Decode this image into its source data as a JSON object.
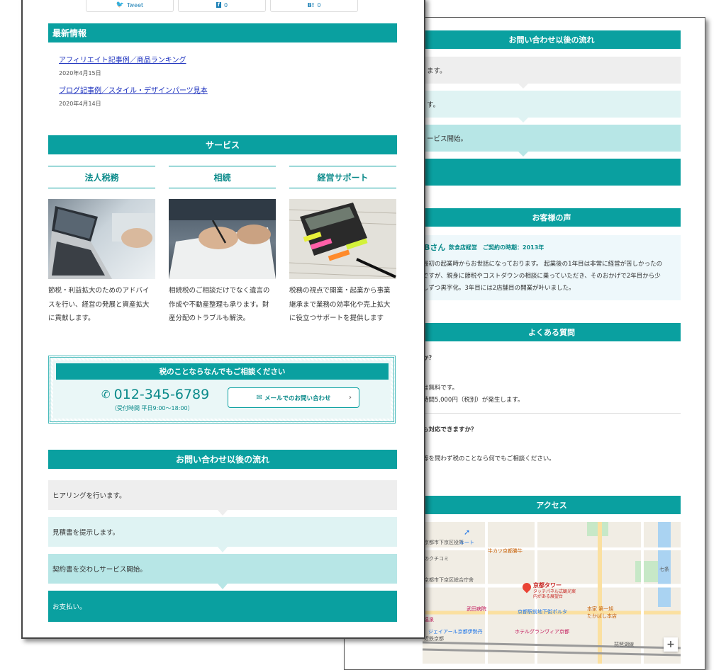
{
  "share": {
    "tweet": "Tweet",
    "facebook": "0",
    "hatena_label": "B!",
    "hatena_count": "0"
  },
  "news": {
    "heading": "最新情報",
    "items": [
      {
        "title": "アフィリエイト記事例／商品ランキング",
        "date": "2020年4月15日"
      },
      {
        "title": "ブログ記事例／スタイル・デザインパーツ見本",
        "date": "2020年4月14日"
      }
    ]
  },
  "services": {
    "heading": "サービス",
    "items": [
      {
        "title": "法人税務",
        "lines": [
          "節税・利益拡大のためのアドバイ",
          "スを行い、経営の発展と資産拡大",
          "に貢献します。"
        ]
      },
      {
        "title": "相続",
        "lines": [
          "相続税のご相談だけでなく遺言の",
          "作成や不動産整理も承ります。財",
          "産分配のトラブルも解決。"
        ]
      },
      {
        "title": "経営サポート",
        "lines": [
          "税務の視点で開業・起業から事業",
          "継承まで業務の効率化や売上拡大",
          "に役立つサポートを提供します"
        ]
      }
    ]
  },
  "contact": {
    "heading": "税のことならなんでもご相談ください",
    "phone": "012-345-6789",
    "hours": "（受付時間 平日9:00〜18:00）",
    "mail_button": "メールでのお問い合わせ"
  },
  "flow": {
    "heading": "お問い合わせ以後の流れ",
    "steps": [
      "ヒアリングを行います。",
      "見積書を提示します。",
      "契約書を交わしサービス開始。",
      "お支払い。"
    ]
  },
  "back": {
    "flow_heading": "お問い合わせ以後の流れ",
    "flow_partials": [
      "ます。",
      "す。",
      "ービス開始。"
    ],
    "voice_heading": "お客様の声",
    "voice_name": "Bさん",
    "voice_meta": "飲食店経営　ご契約の時期：2013年",
    "voice_lines": [
      "最初の起業時からお世話になっております。 起業後の1年目は非常に経営が苦しかったの",
      "ですが、親身に節税やコストダウンの相談に乗っていただき、そのおかげで2年目から少",
      "しずつ黒字化。3年目には2店舗目の開業が叶いました。"
    ],
    "faq_heading": "よくある質問",
    "faq_q1": "か？",
    "faq_a1a": "は無料です。",
    "faq_a1b": "時間5,000円（税別）が発生します。",
    "faq_q2": "も対応できますか？",
    "faq_a2": "等を問わず税のことなら何でもご相談ください。",
    "access_heading": "アクセス",
    "map_labels": {
      "ward": "京都市下京区役所",
      "route": "ルート",
      "tower": "京都タワー",
      "tower_sub": "タッチパネル式観光案内がある展望台",
      "station": "京都駅前地下街ポルタ",
      "hotel": "ホテルグランヴィア京都",
      "isetan": "ジェイアール京都伊勢丹",
      "hospital": "武田病院",
      "onsen": "温泉",
      "gyukatsu": "牛カツ京都勝牛",
      "honke": "本家 第一旭",
      "takabashi": "たかばし本店",
      "kuchikomi": "のクチコミ",
      "ward_office": "京都市下京区総合庁舎",
      "shichijo": "七条",
      "kinki": "近鉄京都",
      "biwako": "琵琶湖線",
      "zoom_in": "+"
    }
  }
}
